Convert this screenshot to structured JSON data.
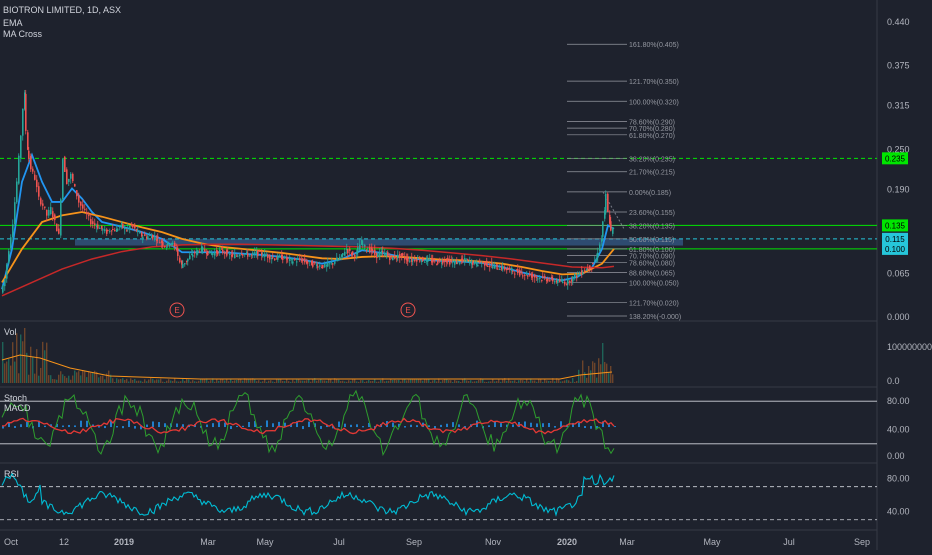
{
  "header": {
    "symbol_line": "BIOTRON LIMITED, 1D, ASX",
    "indicator_1": "EMA",
    "indicator_2": "MA Cross"
  },
  "colors": {
    "background": "#1e222d",
    "grid": "#2a2e39",
    "candle_up": "#26a69a",
    "candle_down": "#ef5350",
    "ema_fast": "#2196f3",
    "ema_mid": "#f7931a",
    "ma_slow": "#c62828",
    "green_line": "#00e600",
    "support_zone": "#3d6ea8",
    "stoch_k": "#2e9e2e",
    "stoch_d": "#e53935",
    "macd_hist": "#2196f3",
    "rsi": "#00bcd4",
    "volume_bar": "#7a4a2a"
  },
  "chart_data": [
    {
      "type": "candlestick",
      "pane": "price",
      "y_ticks": [
        "0.440",
        "0.375",
        "0.315",
        "0.250",
        "0.190",
        "0.065",
        "0.000"
      ],
      "ylim": [
        0.0,
        0.45
      ],
      "x_ticks": [
        "Oct",
        "12",
        "2019",
        "Mar",
        "May",
        "Jul",
        "Sep",
        "Nov",
        "2020",
        "Mar",
        "May",
        "Jul",
        "Sep"
      ],
      "price_path": [
        [
          0,
          0.035
        ],
        [
          4,
          0.055
        ],
        [
          8,
          0.1
        ],
        [
          12,
          0.14
        ],
        [
          16,
          0.2
        ],
        [
          20,
          0.27
        ],
        [
          23,
          0.33
        ],
        [
          26,
          0.25
        ],
        [
          30,
          0.22
        ],
        [
          34,
          0.205
        ],
        [
          38,
          0.175
        ],
        [
          42,
          0.165
        ],
        [
          46,
          0.15
        ],
        [
          50,
          0.16
        ],
        [
          54,
          0.14
        ],
        [
          58,
          0.12
        ],
        [
          62,
          0.235
        ],
        [
          66,
          0.2
        ],
        [
          70,
          0.21
        ],
        [
          74,
          0.19
        ],
        [
          78,
          0.17
        ],
        [
          82,
          0.16
        ],
        [
          86,
          0.15
        ],
        [
          90,
          0.14
        ],
        [
          95,
          0.135
        ],
        [
          100,
          0.13
        ],
        [
          105,
          0.125
        ],
        [
          110,
          0.13
        ],
        [
          115,
          0.128
        ],
        [
          120,
          0.135
        ],
        [
          125,
          0.128
        ],
        [
          130,
          0.135
        ],
        [
          135,
          0.127
        ],
        [
          140,
          0.12
        ],
        [
          145,
          0.118
        ],
        [
          150,
          0.12
        ],
        [
          155,
          0.116
        ],
        [
          160,
          0.11
        ],
        [
          165,
          0.105
        ],
        [
          170,
          0.11
        ],
        [
          175,
          0.1
        ],
        [
          180,
          0.075
        ],
        [
          185,
          0.082
        ],
        [
          190,
          0.09
        ],
        [
          195,
          0.095
        ],
        [
          200,
          0.1
        ],
        [
          205,
          0.096
        ],
        [
          210,
          0.093
        ],
        [
          215,
          0.095
        ],
        [
          220,
          0.097
        ],
        [
          225,
          0.094
        ],
        [
          230,
          0.09
        ],
        [
          235,
          0.09
        ],
        [
          240,
          0.095
        ],
        [
          245,
          0.092
        ],
        [
          250,
          0.09
        ],
        [
          255,
          0.094
        ],
        [
          260,
          0.092
        ],
        [
          265,
          0.09
        ],
        [
          270,
          0.088
        ],
        [
          275,
          0.086
        ],
        [
          280,
          0.088
        ],
        [
          285,
          0.085
        ],
        [
          290,
          0.082
        ],
        [
          295,
          0.083
        ],
        [
          300,
          0.084
        ],
        [
          305,
          0.08
        ],
        [
          310,
          0.078
        ],
        [
          315,
          0.076
        ],
        [
          320,
          0.075
        ],
        [
          325,
          0.074
        ],
        [
          330,
          0.078
        ],
        [
          335,
          0.083
        ],
        [
          340,
          0.088
        ],
        [
          345,
          0.1
        ],
        [
          350,
          0.093
        ],
        [
          355,
          0.092
        ],
        [
          360,
          0.11
        ],
        [
          365,
          0.1
        ],
        [
          370,
          0.098
        ],
        [
          375,
          0.09
        ],
        [
          380,
          0.094
        ],
        [
          385,
          0.092
        ],
        [
          390,
          0.086
        ],
        [
          395,
          0.088
        ],
        [
          400,
          0.09
        ],
        [
          405,
          0.085
        ],
        [
          410,
          0.083
        ],
        [
          415,
          0.085
        ],
        [
          420,
          0.084
        ],
        [
          425,
          0.083
        ],
        [
          430,
          0.082
        ],
        [
          435,
          0.08
        ],
        [
          440,
          0.082
        ],
        [
          445,
          0.083
        ],
        [
          450,
          0.08
        ],
        [
          455,
          0.08
        ],
        [
          460,
          0.082
        ],
        [
          465,
          0.083
        ],
        [
          470,
          0.08
        ],
        [
          475,
          0.078
        ],
        [
          480,
          0.08
        ],
        [
          485,
          0.078
        ],
        [
          490,
          0.075
        ],
        [
          495,
          0.073
        ],
        [
          500,
          0.072
        ],
        [
          505,
          0.07
        ],
        [
          510,
          0.068
        ],
        [
          515,
          0.066
        ],
        [
          520,
          0.064
        ],
        [
          525,
          0.062
        ],
        [
          530,
          0.06
        ],
        [
          535,
          0.058
        ],
        [
          540,
          0.056
        ],
        [
          545,
          0.055
        ],
        [
          550,
          0.054
        ],
        [
          555,
          0.052
        ],
        [
          560,
          0.051
        ],
        [
          565,
          0.05
        ],
        [
          570,
          0.055
        ],
        [
          575,
          0.06
        ],
        [
          580,
          0.065
        ],
        [
          585,
          0.07
        ],
        [
          590,
          0.075
        ],
        [
          595,
          0.085
        ],
        [
          600,
          0.115
        ],
        [
          603,
          0.155
        ],
        [
          605,
          0.18
        ],
        [
          608,
          0.14
        ],
        [
          610,
          0.125
        ],
        [
          612,
          0.13
        ]
      ],
      "series": [
        {
          "name": "EMA fast",
          "points": [
            [
              0,
              0.04
            ],
            [
              10,
              0.1
            ],
            [
              20,
              0.2
            ],
            [
              30,
              0.24
            ],
            [
              40,
              0.2
            ],
            [
              50,
              0.17
            ],
            [
              60,
              0.17
            ],
            [
              70,
              0.19
            ],
            [
              80,
              0.175
            ],
            [
              90,
              0.155
            ],
            [
              100,
              0.14
            ],
            [
              120,
              0.133
            ],
            [
              140,
              0.125
            ],
            [
              160,
              0.115
            ],
            [
              180,
              0.095
            ],
            [
              200,
              0.095
            ],
            [
              220,
              0.095
            ],
            [
              240,
              0.093
            ],
            [
              260,
              0.091
            ],
            [
              280,
              0.088
            ],
            [
              300,
              0.084
            ],
            [
              320,
              0.078
            ],
            [
              340,
              0.085
            ],
            [
              360,
              0.098
            ],
            [
              380,
              0.094
            ],
            [
              400,
              0.088
            ],
            [
              420,
              0.084
            ],
            [
              440,
              0.082
            ],
            [
              460,
              0.081
            ],
            [
              480,
              0.079
            ],
            [
              500,
              0.073
            ],
            [
              520,
              0.065
            ],
            [
              540,
              0.058
            ],
            [
              560,
              0.053
            ],
            [
              575,
              0.058
            ],
            [
              590,
              0.072
            ],
            [
              600,
              0.1
            ],
            [
              606,
              0.135
            ],
            [
              612,
              0.13
            ]
          ]
        },
        {
          "name": "EMA mid",
          "points": [
            [
              0,
              0.05
            ],
            [
              20,
              0.1
            ],
            [
              40,
              0.14
            ],
            [
              60,
              0.15
            ],
            [
              80,
              0.155
            ],
            [
              100,
              0.148
            ],
            [
              120,
              0.14
            ],
            [
              140,
              0.132
            ],
            [
              160,
              0.125
            ],
            [
              180,
              0.115
            ],
            [
              200,
              0.108
            ],
            [
              220,
              0.103
            ],
            [
              240,
              0.1
            ],
            [
              260,
              0.097
            ],
            [
              280,
              0.094
            ],
            [
              300,
              0.09
            ],
            [
              320,
              0.086
            ],
            [
              340,
              0.085
            ],
            [
              360,
              0.088
            ],
            [
              380,
              0.089
            ],
            [
              400,
              0.088
            ],
            [
              420,
              0.086
            ],
            [
              440,
              0.084
            ],
            [
              460,
              0.083
            ],
            [
              480,
              0.081
            ],
            [
              500,
              0.078
            ],
            [
              520,
              0.073
            ],
            [
              540,
              0.067
            ],
            [
              560,
              0.062
            ],
            [
              580,
              0.063
            ],
            [
              600,
              0.078
            ],
            [
              612,
              0.1
            ]
          ]
        },
        {
          "name": "MA slow",
          "points": [
            [
              0,
              0.03
            ],
            [
              30,
              0.05
            ],
            [
              60,
              0.07
            ],
            [
              90,
              0.085
            ],
            [
              120,
              0.096
            ],
            [
              150,
              0.103
            ],
            [
              180,
              0.106
            ],
            [
              210,
              0.107
            ],
            [
              240,
              0.107
            ],
            [
              270,
              0.106
            ],
            [
              300,
              0.105
            ],
            [
              330,
              0.104
            ],
            [
              360,
              0.103
            ],
            [
              390,
              0.101
            ],
            [
              420,
              0.098
            ],
            [
              450,
              0.094
            ],
            [
              480,
              0.09
            ],
            [
              510,
              0.085
            ],
            [
              540,
              0.079
            ],
            [
              570,
              0.073
            ],
            [
              600,
              0.072
            ],
            [
              612,
              0.074
            ]
          ]
        }
      ],
      "horizontal_levels": [
        {
          "name": "green_dashed",
          "value": 0.235,
          "label": "0.235",
          "style": "dashed"
        },
        {
          "name": "green_solid_135",
          "value": 0.135,
          "label": "0.135",
          "style": "solid"
        },
        {
          "name": "green_solid_100",
          "value": 0.1,
          "label": "0.100",
          "style": "solid"
        },
        {
          "name": "cyan_dashed_115",
          "value": 0.115,
          "label": "0.115",
          "style": "dashed"
        }
      ],
      "support_zone": {
        "from": 0.105,
        "to": 0.115
      },
      "fib_levels": [
        {
          "value": 0.405,
          "label": "161.80%(0.405)"
        },
        {
          "value": 0.35,
          "label": "121.70%(0.350)"
        },
        {
          "value": 0.32,
          "label": "100.00%(0.320)"
        },
        {
          "value": 0.29,
          "label": "78.60%(0.290)"
        },
        {
          "value": 0.28,
          "label": "70.70%(0.280)"
        },
        {
          "value": 0.27,
          "label": "61.80%(0.270)"
        },
        {
          "value": 0.235,
          "label": "38.20%(0.235)"
        },
        {
          "value": 0.215,
          "label": "21.70%(0.215)"
        },
        {
          "value": 0.185,
          "label": "0.00%(0.185)"
        },
        {
          "value": 0.155,
          "label": "23.60%(0.155)"
        },
        {
          "value": 0.135,
          "label": "38.20%(0.135)"
        },
        {
          "value": 0.115,
          "label": "50.00%(0.115)"
        },
        {
          "value": 0.1,
          "label": "61.80%(0.100)"
        },
        {
          "value": 0.09,
          "label": "70.70%(0.090)"
        },
        {
          "value": 0.08,
          "label": "78.60%(0.080)"
        },
        {
          "value": 0.065,
          "label": "88.60%(0.065)"
        },
        {
          "value": 0.05,
          "label": "100.00%(0.050)"
        },
        {
          "value": 0.02,
          "label": "121.70%(0.020)"
        },
        {
          "value": -0.0,
          "label": "138.20%(-0.000)"
        }
      ],
      "markers": [
        "E",
        "E"
      ]
    },
    {
      "type": "bar",
      "pane": "volume",
      "title": "Vol",
      "y_ticks": [
        "100000000.0",
        "0.0"
      ]
    },
    {
      "type": "line",
      "pane": "stoch_macd",
      "labels": [
        "Stoch",
        "MACD"
      ],
      "y_ticks": [
        "80.00",
        "40.00",
        "0.00"
      ],
      "ylim": [
        0,
        100
      ],
      "bands": [
        80,
        20
      ]
    },
    {
      "type": "line",
      "pane": "rsi",
      "title": "RSI",
      "y_ticks": [
        "80.00",
        "40.00"
      ],
      "ylim": [
        20,
        95
      ],
      "bands": [
        70,
        30
      ]
    }
  ]
}
